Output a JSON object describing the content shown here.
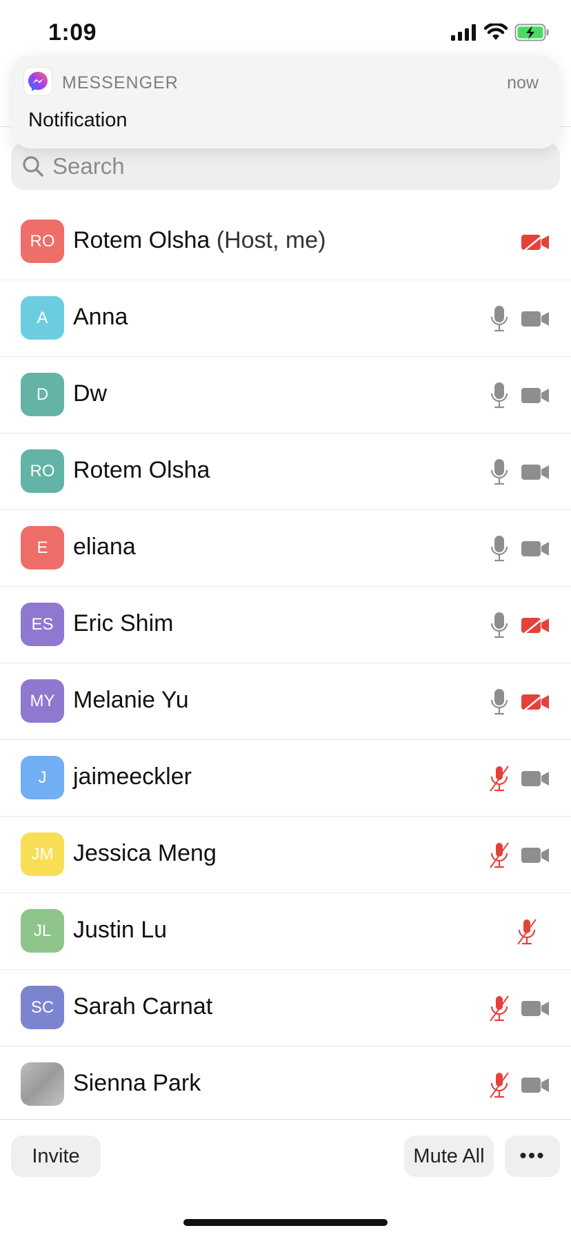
{
  "status_bar": {
    "time": "1:09"
  },
  "notification": {
    "app_name": "MESSENGER",
    "time": "now",
    "body": "Notification"
  },
  "search": {
    "placeholder": "Search",
    "value": ""
  },
  "participants": [
    {
      "initials": "RO",
      "name": "Rotem Olsha",
      "suffix": "(Host, me)",
      "avatar_color": "#ee6e6a",
      "mic": "none",
      "video": "off"
    },
    {
      "initials": "A",
      "name": "Anna",
      "suffix": "",
      "avatar_color": "#6ccde0",
      "mic": "on",
      "video": "on"
    },
    {
      "initials": "D",
      "name": "Dw",
      "suffix": "",
      "avatar_color": "#63b3a6",
      "mic": "on",
      "video": "on"
    },
    {
      "initials": "RO",
      "name": "Rotem Olsha",
      "suffix": "",
      "avatar_color": "#63b3a6",
      "mic": "on",
      "video": "on"
    },
    {
      "initials": "E",
      "name": "eliana",
      "suffix": "",
      "avatar_color": "#ee6e6a",
      "mic": "on",
      "video": "on"
    },
    {
      "initials": "ES",
      "name": "Eric Shim",
      "suffix": "",
      "avatar_color": "#8f78cf",
      "mic": "on",
      "video": "off"
    },
    {
      "initials": "MY",
      "name": "Melanie Yu",
      "suffix": "",
      "avatar_color": "#8f78cf",
      "mic": "on",
      "video": "off"
    },
    {
      "initials": "J",
      "name": "jaimeeckler",
      "suffix": "",
      "avatar_color": "#71aef3",
      "mic": "muted",
      "video": "on"
    },
    {
      "initials": "JM",
      "name": "Jessica Meng",
      "suffix": "",
      "avatar_color": "#f7de55",
      "mic": "muted",
      "video": "on"
    },
    {
      "initials": "JL",
      "name": "Justin Lu",
      "suffix": "",
      "avatar_color": "#8dc58b",
      "mic": "muted",
      "video": "none"
    },
    {
      "initials": "SC",
      "name": "Sarah Carnat",
      "suffix": "",
      "avatar_color": "#7d84cf",
      "mic": "muted",
      "video": "on"
    },
    {
      "initials": "",
      "name": "Sienna Park",
      "suffix": "",
      "avatar_color": "",
      "avatar_type": "photo",
      "mic": "muted",
      "video": "on"
    }
  ],
  "bottom_bar": {
    "invite_label": "Invite",
    "mute_all_label": "Mute All",
    "more_label": "•••"
  },
  "colors": {
    "muted_red": "#e5413b",
    "icon_gray": "#8e8e8e"
  }
}
